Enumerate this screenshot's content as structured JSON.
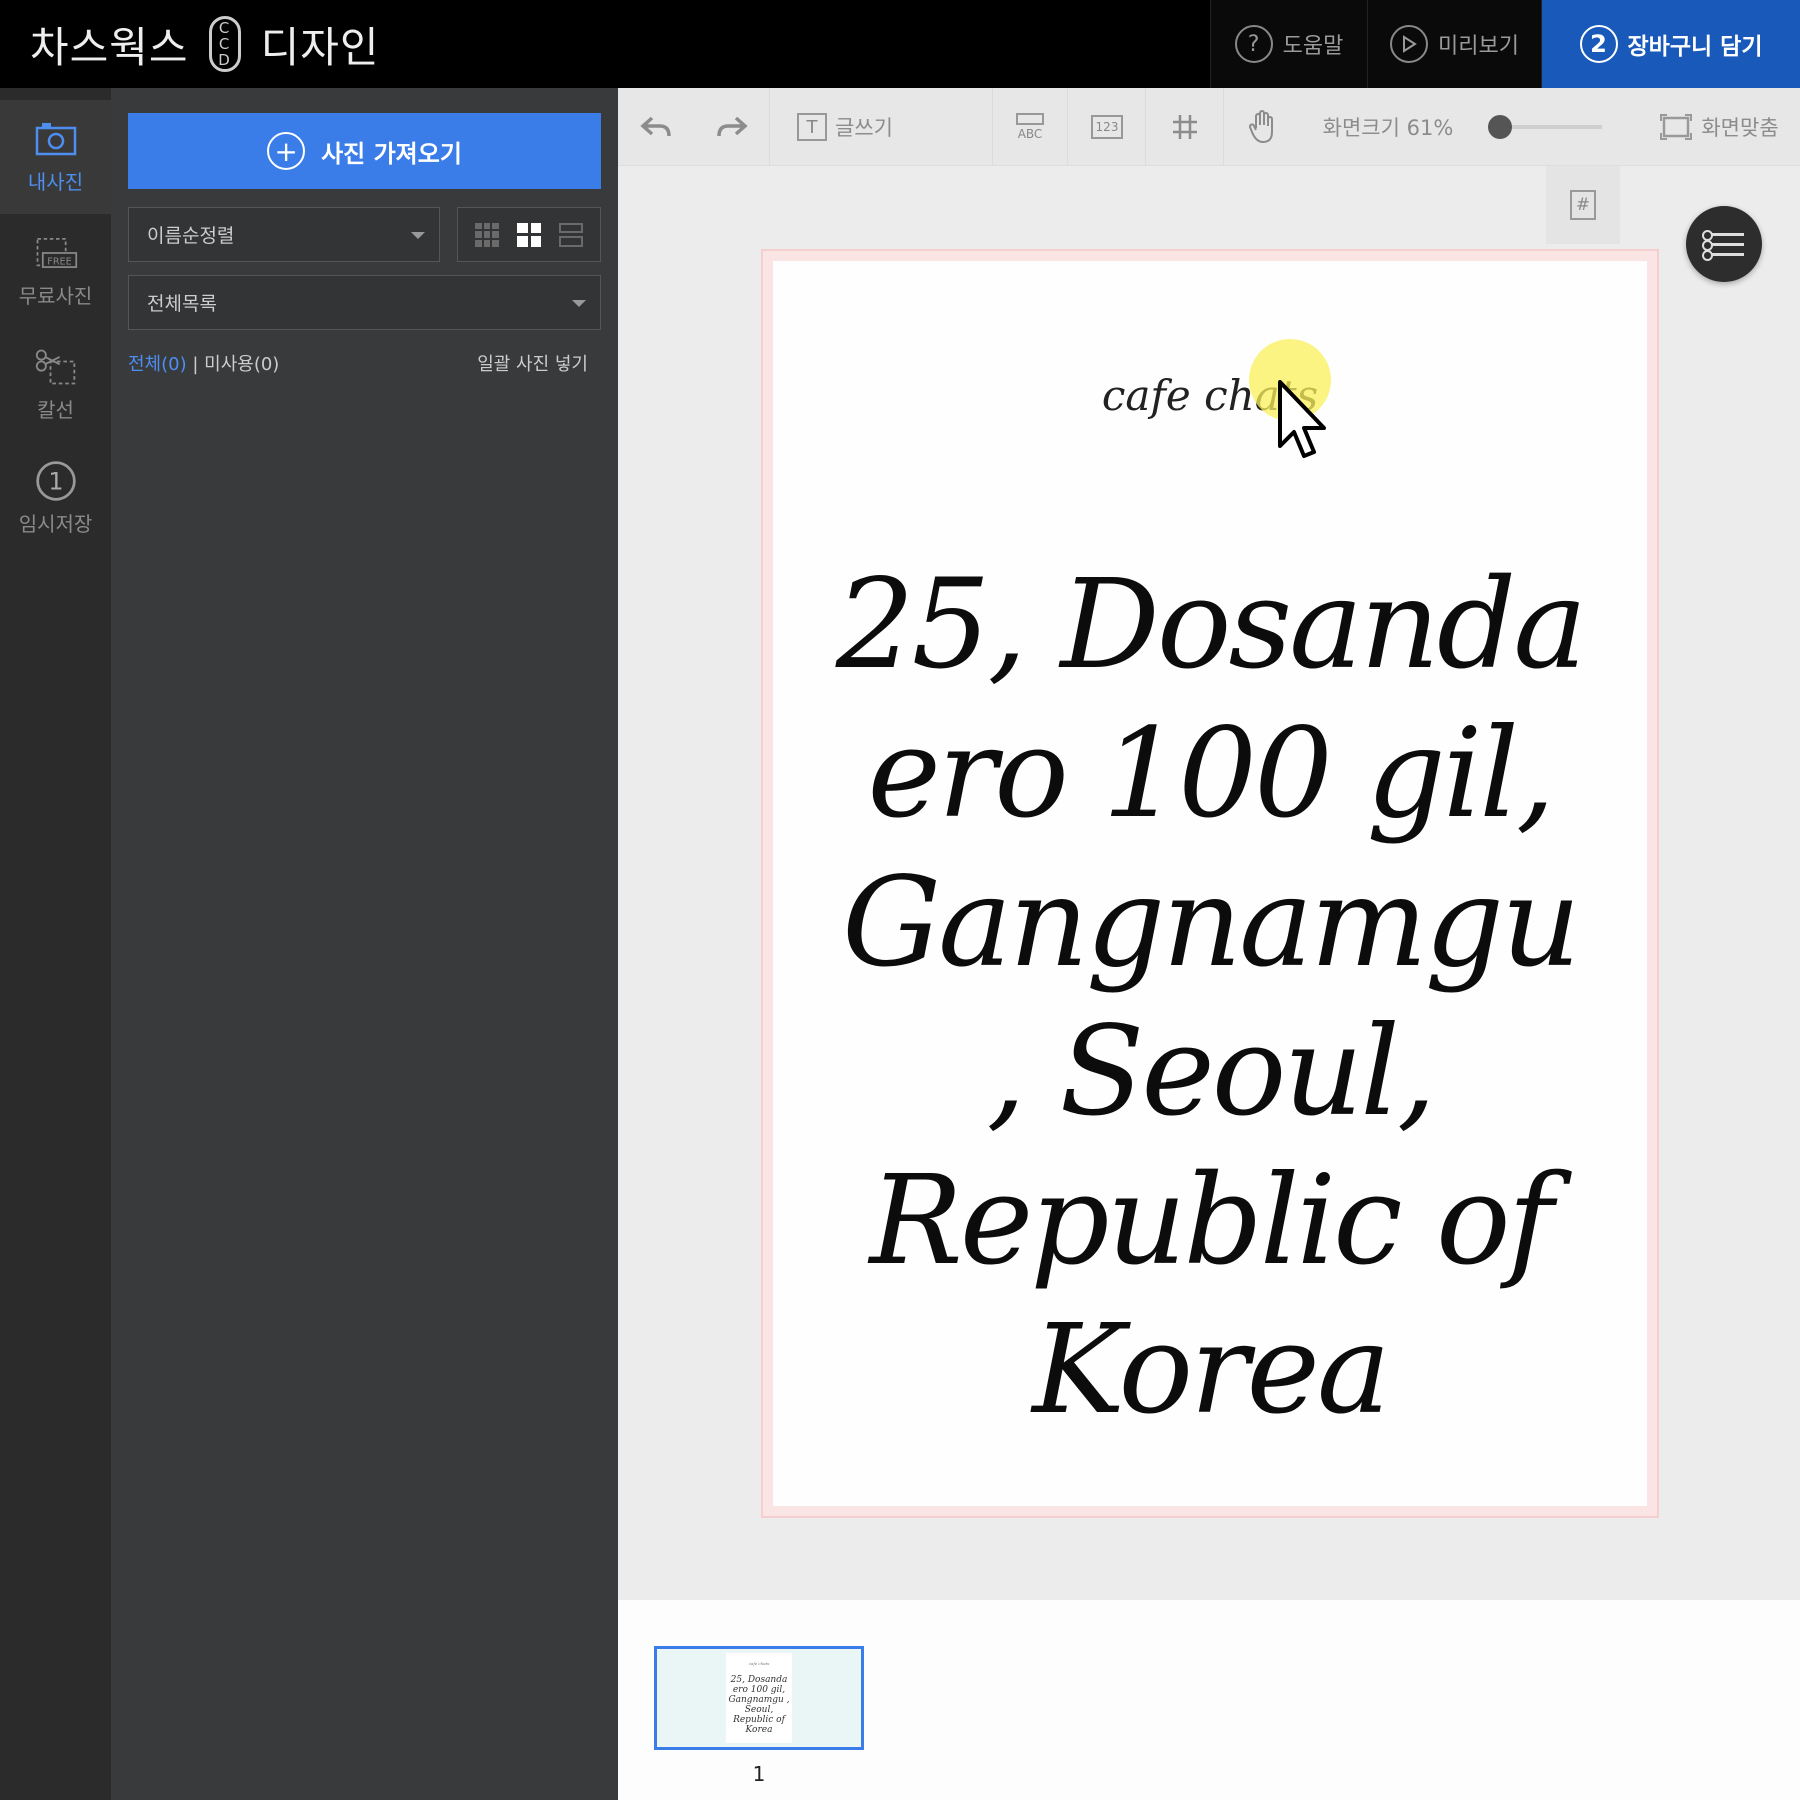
{
  "header": {
    "brand_left": "차스웍스",
    "brand_logo_letters": [
      "C",
      "C",
      "D"
    ],
    "brand_right": "디자인",
    "help_icon": "?",
    "help_label": "도움말",
    "preview_label": "미리보기",
    "cart_step": "2",
    "cart_label": "장바구니 담기",
    "cart_color": "#1859b9"
  },
  "rail": {
    "items": [
      {
        "label": "내사진",
        "icon": "camera-icon",
        "active": true
      },
      {
        "label": "무료사진",
        "icon": "free-photo-icon",
        "badge": "FREE"
      },
      {
        "label": "칼선",
        "icon": "scissors-icon"
      },
      {
        "label": "임시저장",
        "icon": "temp-save-icon",
        "step": "1"
      }
    ]
  },
  "panel": {
    "import_label": "사진 가져오기",
    "sort_value": "이름순정렬",
    "list_value": "전체목록",
    "filter_all": "전체(0)",
    "filter_sep": " | ",
    "filter_unused": "미사용(0)",
    "bulk_insert": "일괄 사진 넣기",
    "accent_color": "#3a7de9"
  },
  "toolbar": {
    "write_text_label": "글쓰기",
    "abc_icon_label": "ABC",
    "number_icon_label": "123",
    "zoom_label": "화면크기 61%",
    "zoom_percent": 61,
    "fit_label": "화면맞춤"
  },
  "page_tool": {
    "icon_label": "#"
  },
  "canvas": {
    "subtitle": "cafe chats",
    "address_lines": [
      "25, Dosanda",
      "ero 100 gil,",
      "Gangnamgu",
      ", Seoul,",
      "Republic of",
      "Korea"
    ]
  },
  "thumbnails": [
    {
      "number": "1",
      "subtitle": "cafe chats",
      "text": "25, Dosanda ero 100 gil, Gangnamgu , Seoul, Republic of Korea"
    }
  ]
}
